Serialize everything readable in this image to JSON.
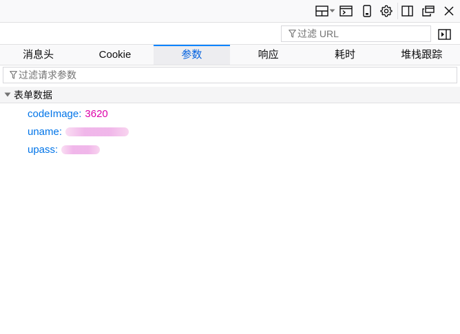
{
  "toolbar": {
    "icons": [
      "layout-dropdown-icon",
      "console-icon",
      "responsive-design-icon",
      "settings-icon",
      "sidebar-icon",
      "new-window-icon",
      "close-icon"
    ]
  },
  "filters": {
    "url_placeholder": "过滤 URL",
    "params_placeholder": "过滤请求参数"
  },
  "tabs": [
    {
      "label": "消息头",
      "selected": false
    },
    {
      "label": "Cookie",
      "selected": false
    },
    {
      "label": "参数",
      "selected": true
    },
    {
      "label": "响应",
      "selected": false
    },
    {
      "label": "耗时",
      "selected": false
    },
    {
      "label": "堆栈跟踪",
      "selected": false
    }
  ],
  "section": {
    "title": "表单数据",
    "expanded": true
  },
  "params": [
    {
      "key": "codeImage",
      "value": "3620",
      "redacted": false
    },
    {
      "key": "uname",
      "value": "",
      "redacted": true
    },
    {
      "key": "upass",
      "value": "",
      "redacted": true
    }
  ],
  "colors": {
    "accent": "#0a84ff",
    "selected_tab_text": "#0060df",
    "param_key": "#0074e8",
    "param_value": "#dd00a9"
  }
}
